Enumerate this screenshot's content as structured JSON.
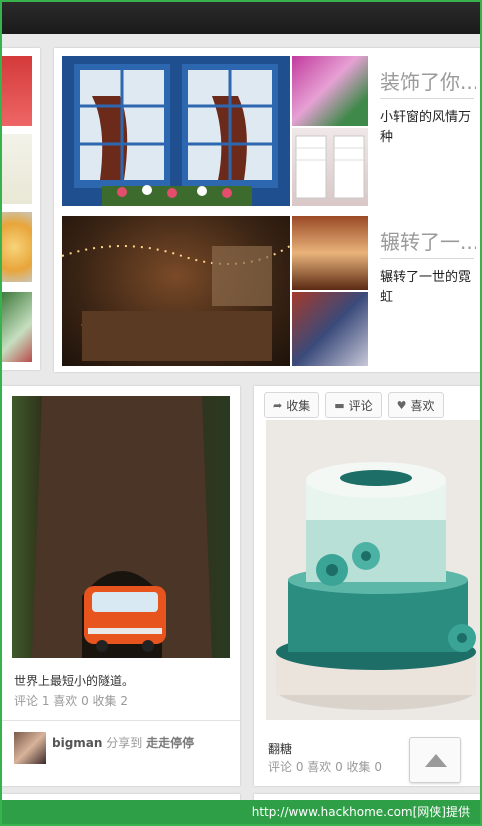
{
  "feed": {
    "board_cards": [
      {
        "title": "装饰了你...",
        "description": "小轩窗的风情万种"
      },
      {
        "title": "辗转了一...",
        "description": "辗转了一世的霓虹"
      }
    ],
    "pins": [
      {
        "description": "世界上最短小的隧道。",
        "stats": "评论 1 喜欢 0 收集 2",
        "user": {
          "name": "bigman",
          "shared_to": "分享到",
          "board": "走走停停"
        }
      },
      {
        "actions": [
          {
            "icon": "share-arrow-icon",
            "label": "收集"
          },
          {
            "icon": "comment-icon",
            "label": "评论"
          },
          {
            "icon": "heart-icon",
            "label": "喜欢"
          }
        ],
        "description": "翻糖",
        "stats": "评论 0 喜欢 0 收集 0"
      }
    ]
  },
  "scroll_top_button": {
    "icon": "arrow-up-icon"
  },
  "watermark": {
    "text": "http://www.hackhome.com[网侠]提供"
  }
}
